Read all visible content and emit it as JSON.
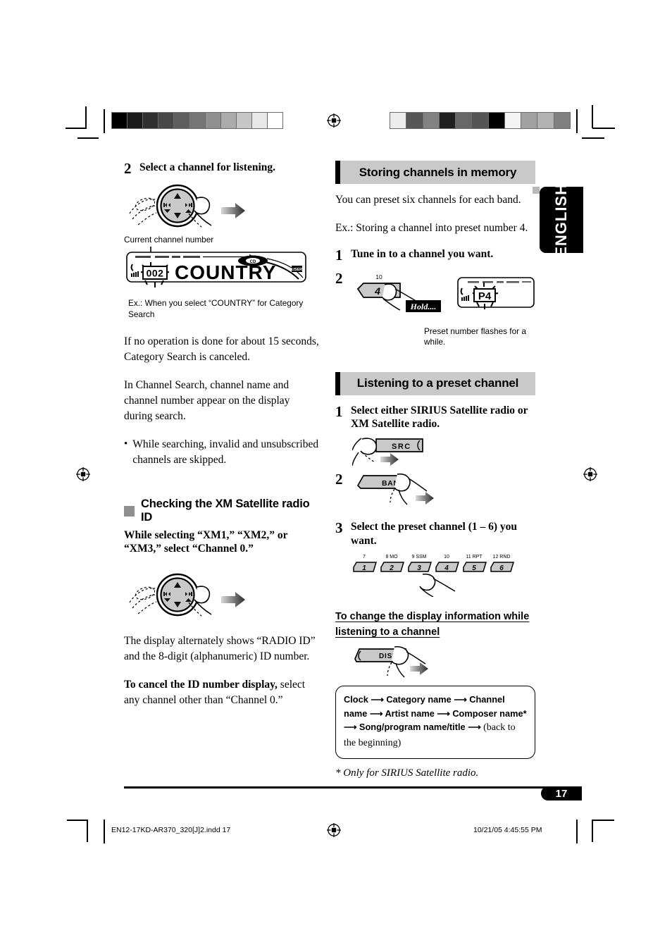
{
  "document": {
    "language_tab": "ENGLISH",
    "page_number": "17",
    "footer_file": "EN12-17KD-AR370_320[J]2.indd   17",
    "footer_timestamp": "10/21/05   4:45:55 PM"
  },
  "colorbars": {
    "left_swatches": [
      "#000000",
      "#1b1b1b",
      "#303030",
      "#484848",
      "#5e5e5e",
      "#757575",
      "#909090",
      "#ababab",
      "#c6c6c6",
      "#e8e8e8",
      "#ffffff"
    ],
    "right_swatches": [
      "#ededed",
      "#565656",
      "#828282",
      "#202020",
      "#676767",
      "#555555",
      "#000000",
      "#f4f4f4",
      "#a2a2a2",
      "#b2b2b2",
      "#808080"
    ]
  },
  "left_column": {
    "step2": {
      "num": "2",
      "text": "Select a channel for listening."
    },
    "dial_caption": "Current channel number",
    "lcd": {
      "channel_number": "002",
      "category_text": "COUNTRY",
      "badge_cd": "CD",
      "badge_user": "USER"
    },
    "lcd_example": "Ex.: When you select “COUNTRY” for Category Search",
    "para1": "If no operation is done for about 15 seconds, Category Search is canceled.",
    "para2": "In Channel Search, channel name and channel number appear on the display during search.",
    "bullet1": "While searching, invalid and unsubscribed channels are skipped.",
    "subsection": {
      "title": "Checking the XM Satellite radio ID",
      "intro": "While selecting “XM1,” “XM2,” or “XM3,” select “Channel 0.”",
      "para1": "The display alternately shows “RADIO ID” and the 8-digit (alphanumeric) ID number.",
      "para2_bold": "To cancel the ID number display,",
      "para2_rest": " select any channel other than “Channel 0.”"
    }
  },
  "right_column": {
    "section1": {
      "title": "Storing channels in memory",
      "para1": "You can preset six channels for each band.",
      "para2": "Ex.: Storing a channel into preset number 4.",
      "step1": {
        "num": "1",
        "text": "Tune in to a channel you want."
      },
      "step2": {
        "num": "2",
        "button_top_label": "10",
        "button_label": "4",
        "hold_label": "Hold....",
        "lcd_preset": "P4",
        "caption": "Preset number flashes for a while."
      }
    },
    "section2": {
      "title": "Listening to a preset channel",
      "step1": {
        "num": "1",
        "text": "Select either SIRIUS Satellite radio or XM Satellite radio.",
        "button": "SRC"
      },
      "step2": {
        "num": "2",
        "button": "BAND"
      },
      "step3": {
        "num": "3",
        "text": "Select the preset channel (1 – 6) you want.",
        "preset_buttons": [
          {
            "top": "7",
            "label": "1"
          },
          {
            "top": "8  MO",
            "label": "2"
          },
          {
            "top": "9  SSM",
            "label": "3"
          },
          {
            "top": "10",
            "label": "4"
          },
          {
            "top": "11  RPT",
            "label": "5"
          },
          {
            "top": "12  RND",
            "label": "6"
          }
        ]
      },
      "display_info": {
        "heading_line1": "To change the display information while",
        "heading_line2": "listening to a channel",
        "button": "DISP",
        "flow_part1": "Clock",
        "flow_part2": "Category name",
        "flow_part3": "Channel name",
        "flow_part4": "Artist name",
        "flow_part5": "Composer name*",
        "flow_part6": "Song/program name/title",
        "flow_tail": "(back to the beginning)",
        "footnote": "*  Only for SIRIUS Satellite radio."
      }
    }
  }
}
